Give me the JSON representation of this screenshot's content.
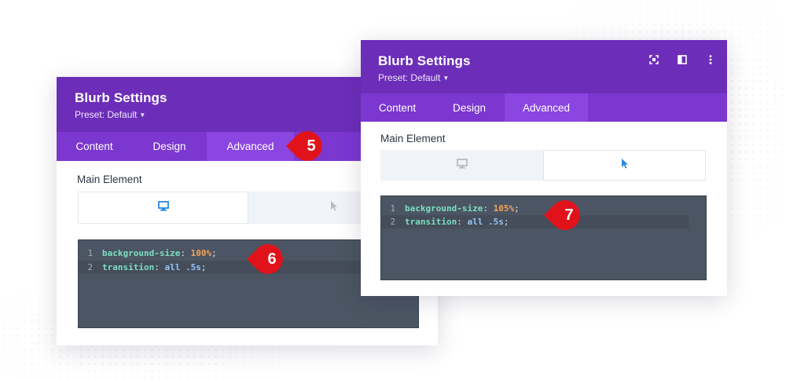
{
  "back_panel": {
    "title": "Blurb Settings",
    "preset": "Preset: Default",
    "tabs": [
      {
        "label": "Content",
        "active": false
      },
      {
        "label": "Design",
        "active": false
      },
      {
        "label": "Advanced",
        "active": true
      }
    ],
    "section_label": "Main Element",
    "state_selected": "desktop",
    "code": [
      {
        "line": "1",
        "property": "background-size",
        "value": "100%"
      },
      {
        "line": "2",
        "property": "transition",
        "value_kw": "all",
        "value_num": ".5s"
      }
    ]
  },
  "front_panel": {
    "title": "Blurb Settings",
    "preset": "Preset: Default",
    "tabs": [
      {
        "label": "Content",
        "active": false
      },
      {
        "label": "Design",
        "active": false
      },
      {
        "label": "Advanced",
        "active": true
      }
    ],
    "section_label": "Main Element",
    "state_selected": "hover",
    "header_icons": [
      "fullscreen-icon",
      "sidebar-layout-icon",
      "more-vertical-icon"
    ],
    "code": [
      {
        "line": "1",
        "property": "background-size",
        "value": "105%"
      },
      {
        "line": "2",
        "property": "transition",
        "value_kw": "all",
        "value_num": ".5s"
      }
    ]
  },
  "markers": {
    "step_5": "5",
    "step_6": "6",
    "step_7": "7"
  },
  "colors": {
    "header": "#6c2eb9",
    "tabs_bar": "#7b37d0",
    "active_tab": "#8b45e0",
    "marker": "#e0131b",
    "editor_bg": "#4b5563",
    "state_icon_active": "#2b87da"
  }
}
